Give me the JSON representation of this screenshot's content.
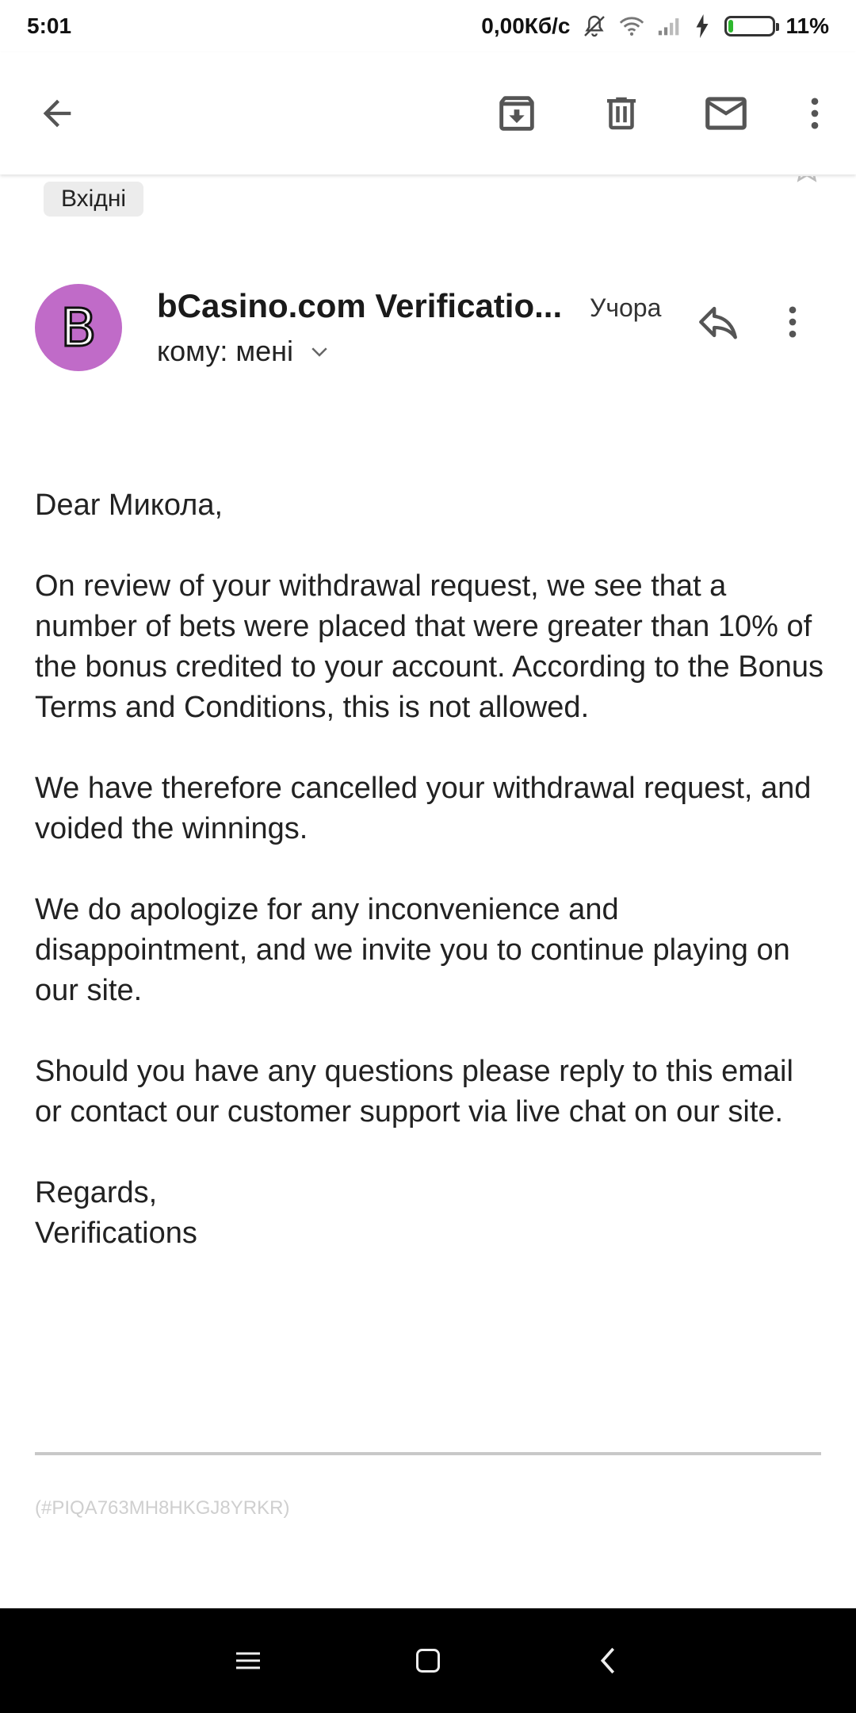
{
  "status_bar": {
    "time": "5:01",
    "network_speed": "0,00Кб/с",
    "battery_percent": "11%",
    "battery_level": 0.11
  },
  "app_bar": {
    "icons": [
      "back-arrow-icon",
      "archive-icon",
      "delete-icon",
      "mail-icon",
      "more-vert-icon"
    ]
  },
  "label": "Вхідні",
  "sender": {
    "avatar_letter": "B",
    "avatar_color": "#c06bc8",
    "name": "bCasino.com Verificatio...",
    "date": "Учора",
    "recipient": "кому: мені"
  },
  "body": {
    "greeting": "Dear Микола,",
    "p1": "On review of your withdrawal request, we see that a number of bets were placed that were greater than 10% of the bonus credited to your account. According to the Bonus Terms and Conditions, this is not allowed.",
    "p2": "We have therefore cancelled your withdrawal request, and voided the winnings.",
    "p3": "We do apologize for any inconvenience and disappointment, and we invite you to continue playing on our site.",
    "p4": "Should you have any questions please reply to this email or contact our customer support via live chat on our site.",
    "regards": "Regards,",
    "signature": "Verifications",
    "ref_code": "(#PIQA763MH8HKGJ8YRKR)"
  }
}
